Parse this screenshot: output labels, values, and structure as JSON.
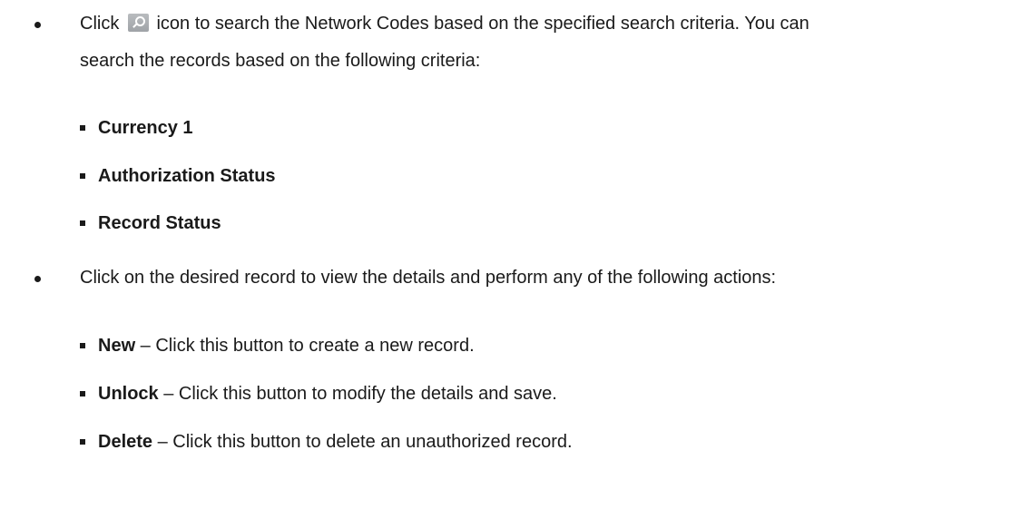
{
  "bullets": [
    {
      "line1_before_icon": "Click",
      "icon": "search-icon",
      "line1_after_icon": "icon to search the Network Codes based on the specified search criteria. You can",
      "line2": "search the records based on the following criteria:",
      "sub_items": [
        {
          "bold": "Currency 1",
          "text": ""
        },
        {
          "bold": "Authorization Status",
          "text": ""
        },
        {
          "bold": "Record Status",
          "text": ""
        }
      ]
    },
    {
      "line1": "Click on the desired record to view the details and perform any of the following actions:",
      "sub_items": [
        {
          "bold": "New",
          "text": " – Click this button to create a new record."
        },
        {
          "bold": "Unlock",
          "text": " – Click this button to modify the details and save."
        },
        {
          "bold": "Delete",
          "text": " – Click this button to delete an unauthorized record."
        }
      ]
    }
  ]
}
